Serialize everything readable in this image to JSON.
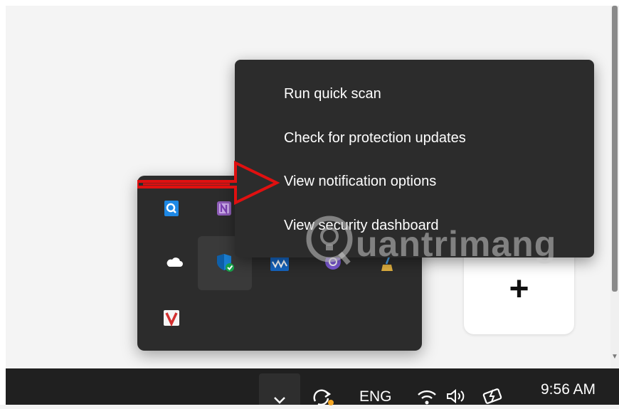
{
  "context_menu": {
    "items": [
      {
        "label": "Run quick scan"
      },
      {
        "label": "Check for protection updates"
      },
      {
        "label": "View notification options"
      },
      {
        "label": "View security dashboard"
      }
    ]
  },
  "tray_flyout": {
    "icons": [
      "magnifier-app-icon",
      "onenote-icon",
      "onedrive-cloud-icon",
      "windows-security-shield-icon",
      "network-monitor-icon",
      "viber-icon",
      "cleaner-broom-icon",
      "antivirus-v-icon"
    ]
  },
  "plus_card": {
    "symbol": "+"
  },
  "watermark": {
    "text": "uantrimang"
  },
  "taskbar": {
    "language": "ENG",
    "time": "9:56 AM"
  },
  "colors": {
    "menu_bg": "#2c2c2c",
    "taskbar_bg": "#202020",
    "arrow_red": "#e01010",
    "shield_blue": "#1a7fd4"
  }
}
